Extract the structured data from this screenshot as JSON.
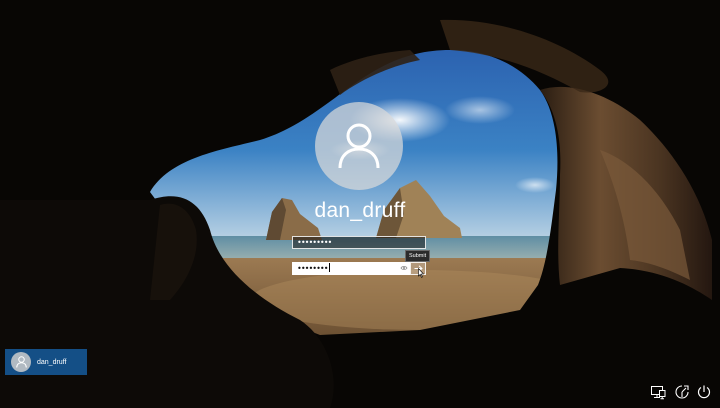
{
  "lock_screen": {
    "username": "dan_druff",
    "old_password_masked": "•••••••••",
    "new_password_masked": "••••••••"
  },
  "submit": {
    "tooltip": "Submit"
  },
  "user_switcher": {
    "items": [
      {
        "label": "dan_druff"
      }
    ]
  },
  "system_tray": {
    "icons": [
      "network-icon",
      "ease-of-access-icon",
      "power-icon"
    ]
  },
  "colors": {
    "user_tile_bg": "#144f86",
    "text": "#ffffff"
  }
}
